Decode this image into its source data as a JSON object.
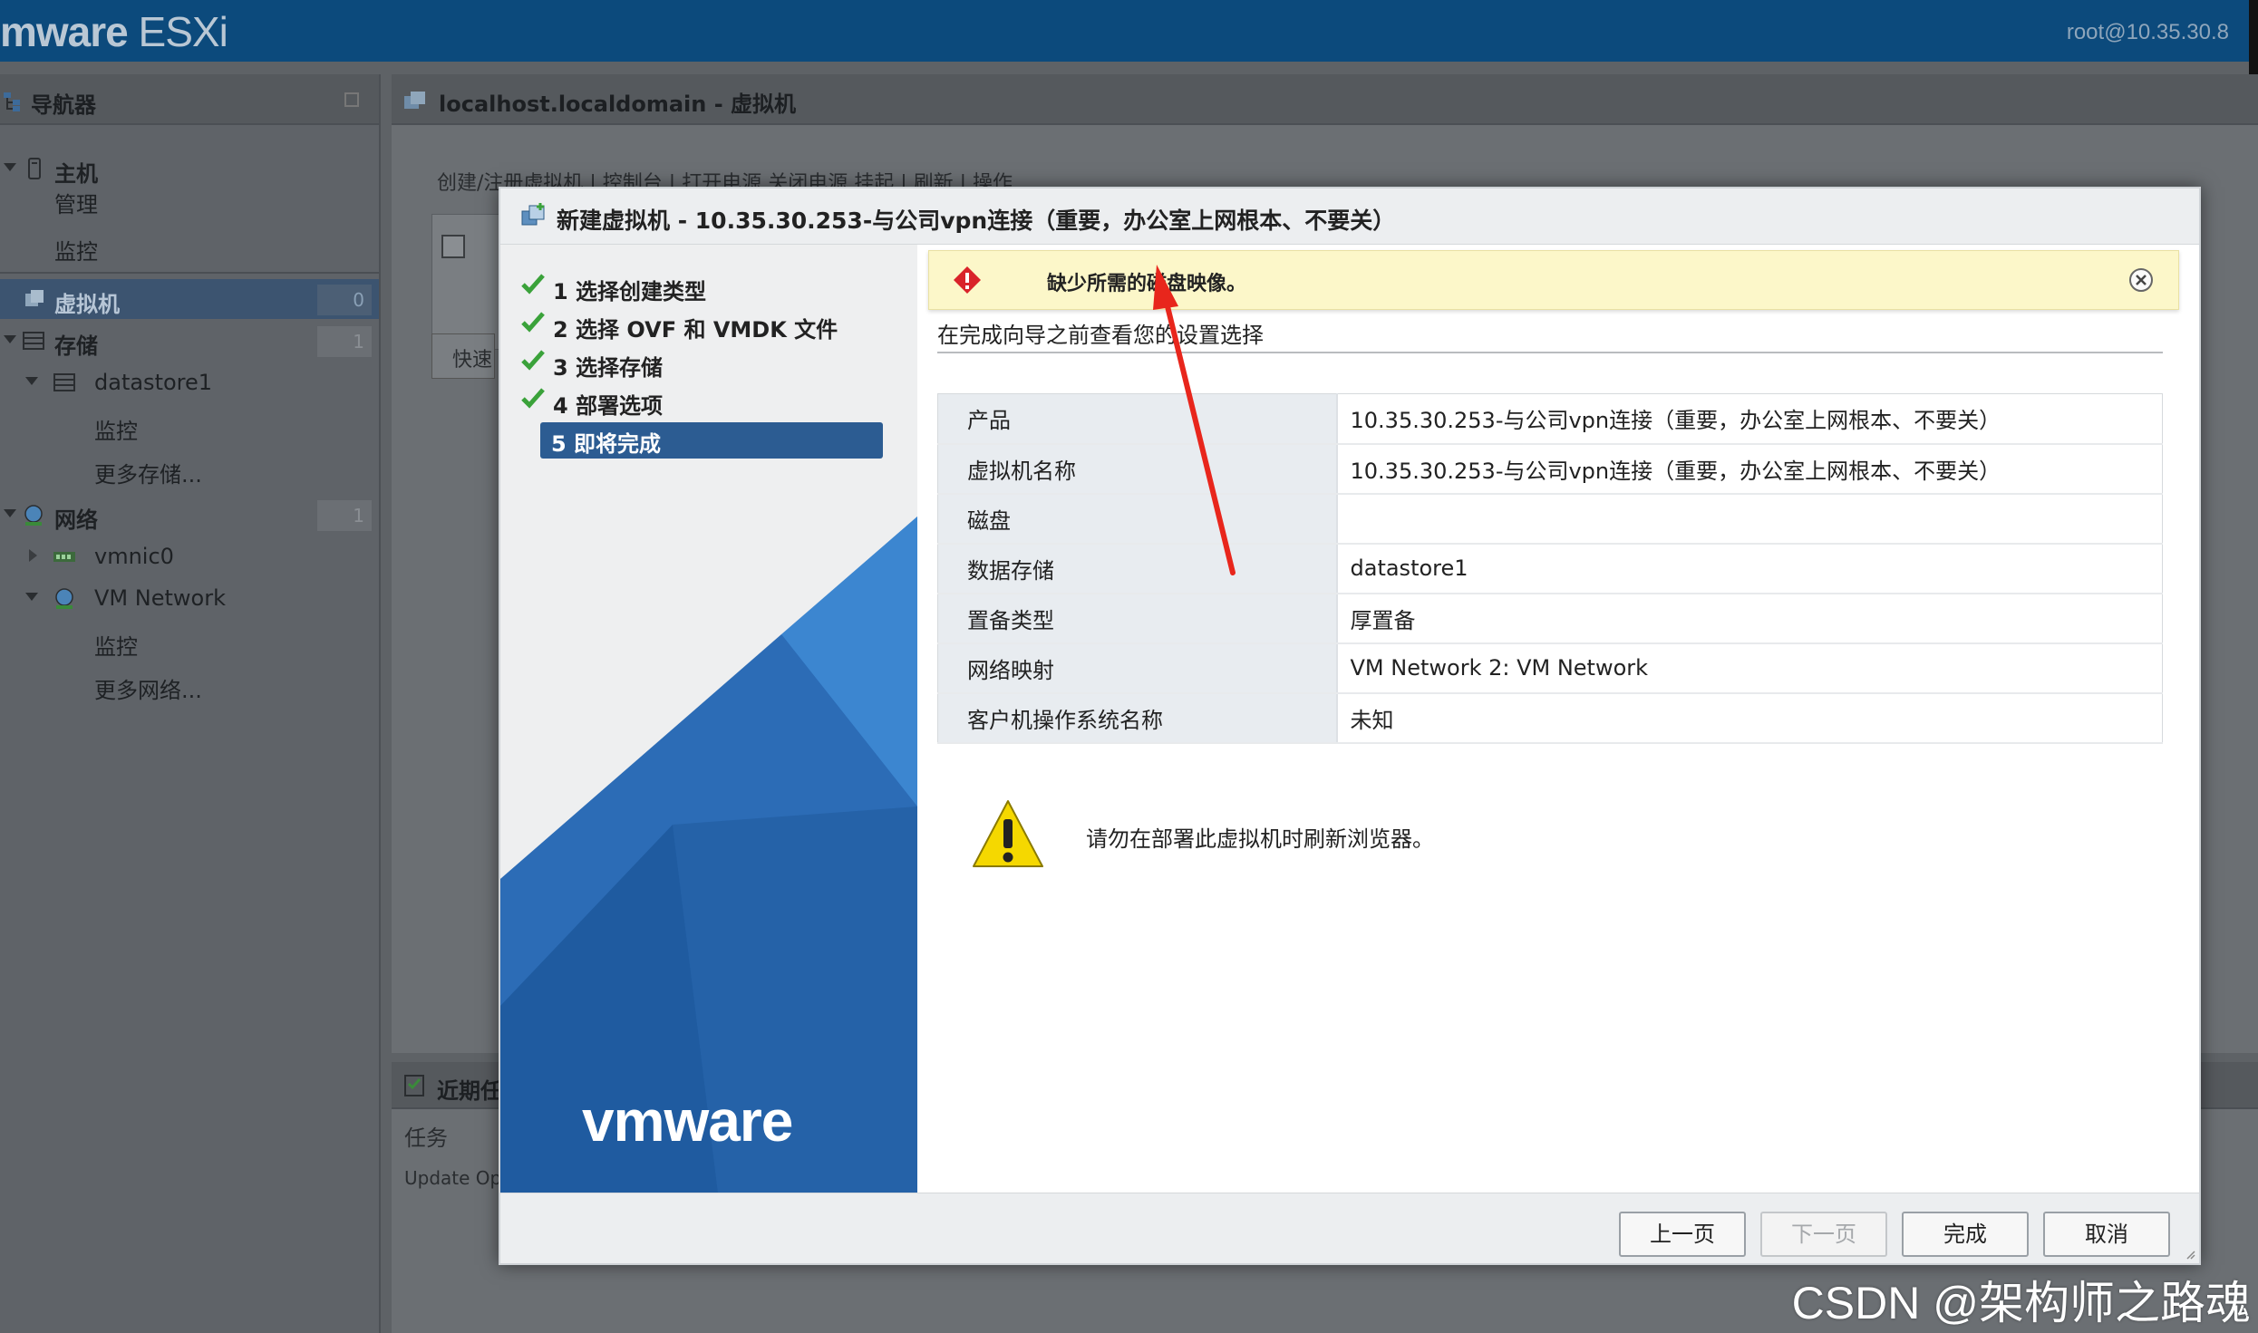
{
  "app": {
    "brand": "vmware ESXi",
    "brand_prefix": "mware",
    "brand_suffix": "ESXi",
    "user": "root@10.35.30.8"
  },
  "navigator": {
    "title": "导航器",
    "items": [
      {
        "label": "主机"
      },
      {
        "label": "管理"
      },
      {
        "label": "监控"
      },
      {
        "label": "虚拟机",
        "badge": "0"
      },
      {
        "label": "存储",
        "badge": "1"
      },
      {
        "label": "datastore1"
      },
      {
        "label": "监控"
      },
      {
        "label": "更多存储..."
      },
      {
        "label": "网络",
        "badge": "1"
      },
      {
        "label": "vmnic0"
      },
      {
        "label": "VM Network"
      },
      {
        "label": "监控"
      },
      {
        "label": "更多网络..."
      }
    ]
  },
  "main": {
    "title": "localhost.localdomain - 虚拟机",
    "toolbar": "创建/注册虚拟机  |  控制台  |  打开电源  关闭电源  挂起  |  刷新  |  操作",
    "quick_filter": "快速",
    "tasks_title": "近期任务",
    "tasks_col": "任务",
    "tasks_row": "Update Opt"
  },
  "dialog": {
    "title": "新建虚拟机 - 10.35.30.253-与公司vpn连接（重要，办公室上网根本、不要关）",
    "steps": [
      {
        "label": "1 选择创建类型",
        "done": true
      },
      {
        "label": "2 选择 OVF 和 VMDK 文件",
        "done": true
      },
      {
        "label": "3 选择存储",
        "done": true
      },
      {
        "label": "4 部署选项",
        "done": true
      },
      {
        "label": "5 即将完成",
        "done": false,
        "current": true
      }
    ],
    "logo": "vmware",
    "alert": "缺少所需的磁盘映像。",
    "intro": "在完成向导之前查看您的设置选择",
    "summary": [
      {
        "key": "产品",
        "value": "10.35.30.253-与公司vpn连接（重要，办公室上网根本、不要关）"
      },
      {
        "key": "虚拟机名称",
        "value": "10.35.30.253-与公司vpn连接（重要，办公室上网根本、不要关）"
      },
      {
        "key": "磁盘",
        "value": ""
      },
      {
        "key": "数据存储",
        "value": "datastore1"
      },
      {
        "key": "置备类型",
        "value": "厚置备"
      },
      {
        "key": "网络映射",
        "value": "VM Network 2: VM Network"
      },
      {
        "key": "客户机操作系统名称",
        "value": "未知"
      }
    ],
    "warning": "请勿在部署此虚拟机时刷新浏览器。",
    "buttons": {
      "back": "上一页",
      "next": "下一页",
      "finish": "完成",
      "cancel": "取消"
    }
  },
  "watermark": "CSDN @架构师之路魂",
  "colors": {
    "topbar": "#0c4a7c",
    "selected_nav": "#3c5470",
    "current_step": "#2c5c92",
    "check": "#3aa23a",
    "alert_bg": "#fcf7c9",
    "error_icon": "#d9232a",
    "arrow": "#e8261c"
  }
}
